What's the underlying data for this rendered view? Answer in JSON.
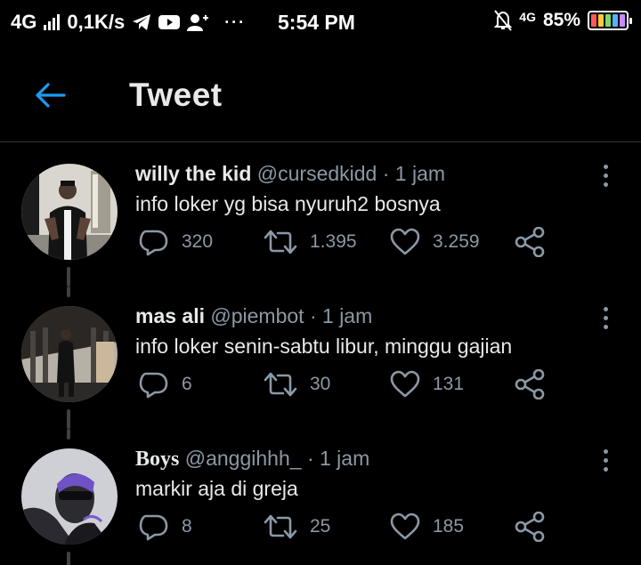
{
  "status_bar": {
    "network": "4G",
    "speed": "0,1K/s",
    "more_indicator": "···",
    "time": "5:54 PM",
    "network_right": "4G",
    "battery": "85%",
    "icons": [
      "signal-icon",
      "telegram-icon",
      "youtube-icon",
      "add-user-icon",
      "mute-bell-icon",
      "battery-icon"
    ]
  },
  "header": {
    "title": "Tweet",
    "back_icon": "back-arrow-icon"
  },
  "tweets": [
    {
      "name": "willy the kid",
      "handle": "@cursedkidd",
      "time": "· 1 jam",
      "text": "info loker yg bisa nyuruh2 bosnya",
      "replies": "320",
      "retweets": "1.395",
      "likes": "3.259"
    },
    {
      "name": "mas ali",
      "handle": "@piembot",
      "time": "· 1 jam",
      "text": "info loker senin-sabtu libur, minggu gajian",
      "replies": "6",
      "retweets": "30",
      "likes": "131"
    },
    {
      "name": "Boys",
      "handle": "@anggihhh_",
      "time": "· 1 jam",
      "text": "markir aja di greja",
      "replies": "8",
      "retweets": "25",
      "likes": "185"
    }
  ],
  "colors": {
    "accent": "#1d9bf0",
    "muted": "#8b98a5",
    "text": "#e7e9ea",
    "background": "#000000"
  }
}
